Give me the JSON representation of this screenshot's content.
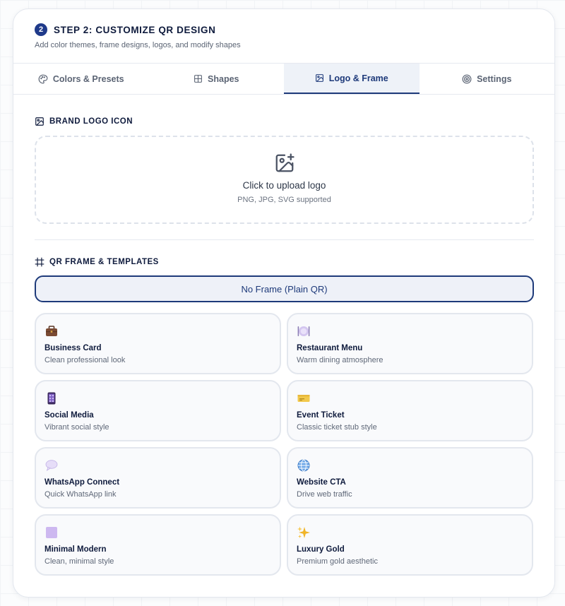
{
  "header": {
    "step_number": "2",
    "title": "STEP 2: CUSTOMIZE QR DESIGN",
    "subtitle": "Add color themes, frame designs, logos, and modify shapes"
  },
  "tabs": [
    {
      "label": "Colors & Presets",
      "icon": "palette-icon",
      "active": false
    },
    {
      "label": "Shapes",
      "icon": "grid-icon",
      "active": false
    },
    {
      "label": "Logo & Frame",
      "icon": "image-icon",
      "active": true
    },
    {
      "label": "Settings",
      "icon": "target-icon",
      "active": false
    }
  ],
  "logo_section": {
    "title": "BRAND LOGO ICON",
    "upload_title": "Click to upload logo",
    "upload_sub": "PNG, JPG, SVG supported"
  },
  "frame_section": {
    "title": "QR FRAME & TEMPLATES",
    "no_frame_label": "No Frame (Plain QR)",
    "templates": [
      {
        "title": "Business Card",
        "desc": "Clean professional look",
        "icon": "briefcase-icon"
      },
      {
        "title": "Restaurant Menu",
        "desc": "Warm dining atmosphere",
        "icon": "plate-cutlery-icon"
      },
      {
        "title": "Social Media",
        "desc": "Vibrant social style",
        "icon": "phone-icon"
      },
      {
        "title": "Event Ticket",
        "desc": "Classic ticket stub style",
        "icon": "ticket-icon"
      },
      {
        "title": "WhatsApp Connect",
        "desc": "Quick WhatsApp link",
        "icon": "speech-bubble-icon"
      },
      {
        "title": "Website CTA",
        "desc": "Drive web traffic",
        "icon": "globe-icon"
      },
      {
        "title": "Minimal Modern",
        "desc": "Clean, minimal style",
        "icon": "square-icon"
      },
      {
        "title": "Luxury Gold",
        "desc": "Premium gold aesthetic",
        "icon": "sparkles-icon"
      }
    ]
  },
  "colors": {
    "accent": "#1e3a7a",
    "step_badge": "#1f3a8a",
    "text_primary": "#0f1b3d",
    "text_muted": "#5b6474"
  }
}
